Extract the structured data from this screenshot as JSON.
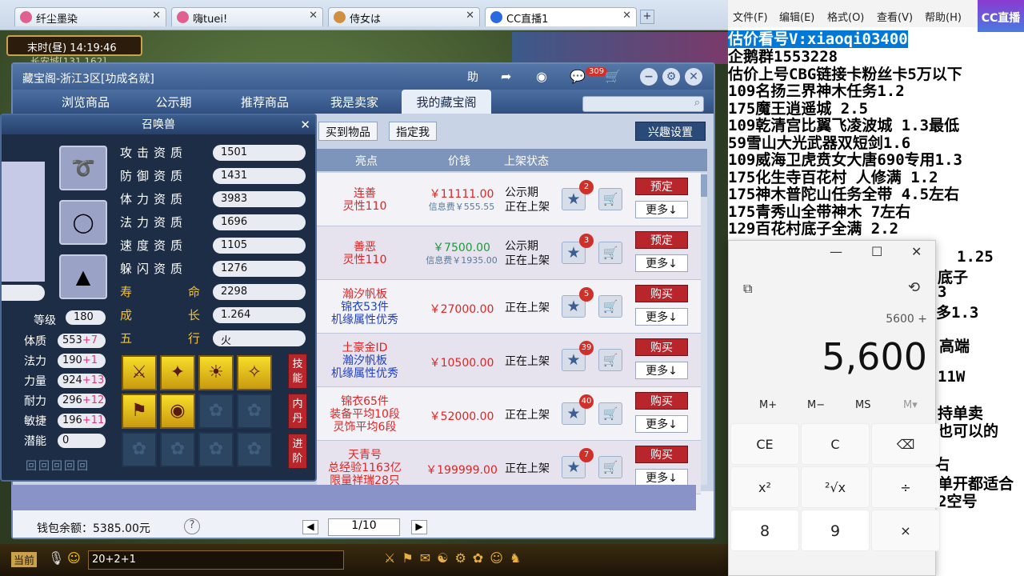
{
  "browser_tabs": [
    {
      "label": "纤尘墨染"
    },
    {
      "label": "嗨tuei!"
    },
    {
      "label": "侍女は"
    },
    {
      "label": "CC直播1"
    }
  ],
  "game": {
    "time_label": "末时(昼)",
    "time": "14:19:46",
    "location": "长安城[131,162]",
    "chat_channel": "当前",
    "chat_input": "20+2+1"
  },
  "cbg": {
    "title": "藏宝阁-浙江3区[功成名就]",
    "help_label": "助",
    "cart_count": "309",
    "tabs": [
      "浏览商品",
      "公示期",
      "推荐商品",
      "我是卖家",
      "我的藏宝阁"
    ],
    "sub_buttons": [
      "买到物品",
      "指定我"
    ],
    "hobby_button": "兴趣设置",
    "columns": [
      "亮点",
      "价钱",
      "上架状态"
    ],
    "rows": [
      {
        "highlight": [
          "连善",
          "灵性110"
        ],
        "highlight_color": "#e02424",
        "price": "￥11111.00",
        "fee": "信息费￥555.55",
        "price_color": "#e02424",
        "status": [
          "公示期",
          "正在上架"
        ],
        "stars": "2",
        "action": "预定",
        "more": "更多↓"
      },
      {
        "highlight": [
          "善恶",
          "灵性110"
        ],
        "highlight_color": "#e02424",
        "price": "￥7500.00",
        "fee": "信息费￥1935.00",
        "price_color": "#1a9a3a",
        "status": [
          "公示期",
          "正在上架"
        ],
        "stars": "3",
        "action": "预定",
        "more": "更多↓"
      },
      {
        "highlight": [
          "瀚汐帆板",
          "锦衣53件",
          "机缘属性优秀"
        ],
        "highlight_color": "#e02424",
        "price": "￥27000.00",
        "fee": "",
        "price_color": "#e02424",
        "status": [
          "正在上架"
        ],
        "stars": "5",
        "action": "购买",
        "more": "更多↓"
      },
      {
        "highlight": [
          "土豪金ID",
          "瀚汐帆板",
          "机缘属性优秀"
        ],
        "highlight_color": "#e02424",
        "price": "￥10500.00",
        "fee": "",
        "price_color": "#e02424",
        "status": [
          "正在上架"
        ],
        "stars": "39",
        "action": "购买",
        "more": "更多↓"
      },
      {
        "highlight": [
          "锦衣65件",
          "装备平均10段",
          "灵饰平均6段"
        ],
        "highlight_color": "#e02424",
        "price": "￥52000.00",
        "fee": "",
        "price_color": "#e02424",
        "status": [
          "正在上架"
        ],
        "stars": "40",
        "action": "购买",
        "more": "更多↓"
      },
      {
        "highlight": [
          "天青号",
          "总经验1163亿",
          "限量祥瑞28只"
        ],
        "highlight_color": "#e02424",
        "price": "￥199999.00",
        "fee": "",
        "price_color": "#e02424",
        "status": [
          "正在上架"
        ],
        "stars": "7",
        "action": "购买",
        "more": "更多↓"
      }
    ],
    "wallet": "钱包余额：5385.00元",
    "help_q": "?",
    "page": "1/10"
  },
  "pet": {
    "title": "召唤兽",
    "stats": [
      {
        "label": "攻击资质",
        "value": "1501"
      },
      {
        "label": "防御资质",
        "value": "1431"
      },
      {
        "label": "体力资质",
        "value": "3983"
      },
      {
        "label": "法力资质",
        "value": "1696"
      },
      {
        "label": "速度资质",
        "value": "1105"
      },
      {
        "label": "躲闪资质",
        "value": "1276"
      },
      {
        "label": "寿命",
        "value": "2298"
      },
      {
        "label": "成长",
        "value": "1.264"
      },
      {
        "label": "五行",
        "value": "火"
      }
    ],
    "level_label": "等级",
    "level": "180",
    "attrs": [
      {
        "label": "体质",
        "value": "553",
        "plus": "+7"
      },
      {
        "label": "法力",
        "value": "190",
        "plus": "+1"
      },
      {
        "label": "力量",
        "value": "924",
        "plus": "+13"
      },
      {
        "label": "耐力",
        "value": "296",
        "plus": "+12"
      },
      {
        "label": "敏捷",
        "value": "196",
        "plus": "+11"
      },
      {
        "label": "潜能",
        "value": "0",
        "plus": ""
      }
    ],
    "side_buttons": [
      "技能",
      "内丹",
      "进阶"
    ]
  },
  "notepad": {
    "menu": [
      "文件(F)",
      "编辑(E)",
      "格式(O)",
      "查看(V)",
      "帮助(H)"
    ],
    "selected": "估价看号V:xiaoqi03400",
    "lines": [
      "企鹅群1553228",
      "估价上号CBG链接卡粉丝卡5万以下",
      "109名扬三界神木任务1.2",
      "175魔王逍遥城 2.5",
      "109乾清宫比翼飞凌波城 1.3最低",
      "59雪山大光武器双短剑1.6",
      "109威海卫虎贲女大唐690专用1.3",
      "175化生寺百花村 人修满 1.2",
      "175神木普陀山任务全带 4.5左右",
      "175青秀山全带神木  7左右",
      "129百花村底子全满 2.2"
    ],
    "partial": [
      "1.25",
      "底子",
      "3",
      "多1.3",
      "高端",
      "11W",
      "持单卖",
      "也可以的",
      "右",
      "单开都适合",
      "2空号"
    ]
  },
  "calculator": {
    "expression": "5600 +",
    "display": "5,600",
    "memory": [
      "M+",
      "M−",
      "MS",
      "M▾"
    ],
    "keys": [
      "CE",
      "C",
      "⌫",
      "x²",
      "²√x",
      "÷",
      "8",
      "9",
      "×"
    ]
  },
  "cc_logo": "CC直播"
}
